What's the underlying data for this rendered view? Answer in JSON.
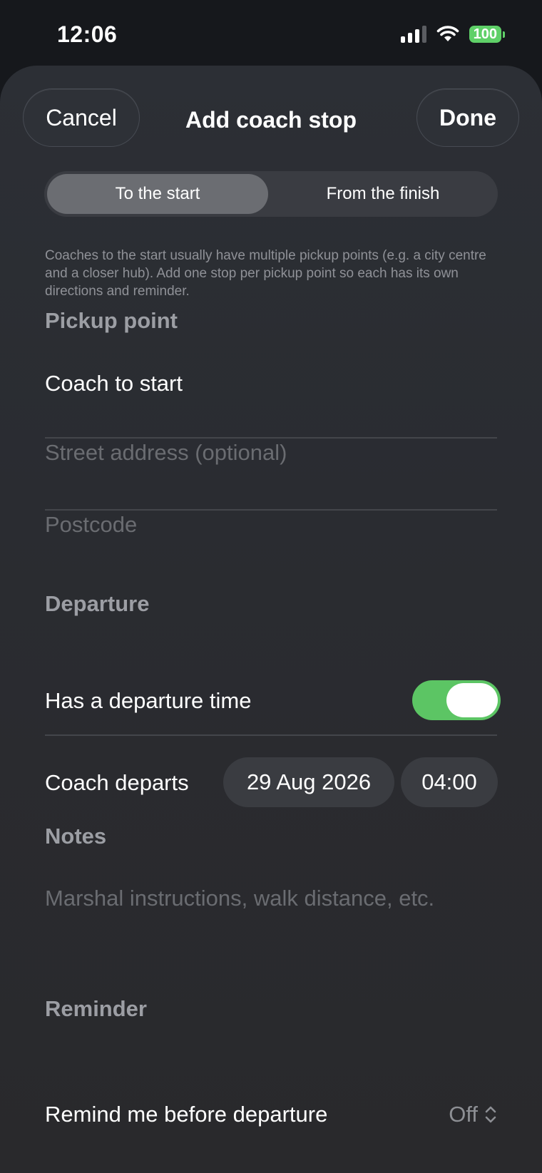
{
  "status_bar": {
    "time": "12:06",
    "battery": "100",
    "icons": [
      "cellular-signal-icon",
      "wifi-icon",
      "battery-icon"
    ],
    "battery_color": "#5fd068"
  },
  "nav": {
    "cancel_label": "Cancel",
    "title": "Add coach stop",
    "done_label": "Done"
  },
  "segmented": {
    "options": [
      "To the start",
      "From the finish"
    ],
    "selected": "To the start"
  },
  "helper_text": "Coaches to the start usually have multiple pickup points (e.g. a city centre and a closer hub). Add one stop per pickup point so each has its own directions and reminder.",
  "pickup": {
    "header": "Pickup point",
    "name_value": "Coach to start",
    "address_placeholder": "Street address (optional)",
    "postcode_placeholder": "Postcode"
  },
  "departure": {
    "header": "Departure",
    "toggle_label": "Has a departure time",
    "toggle_on": true,
    "toggle_color": "#5cc564",
    "departs_label": "Coach departs",
    "date": "29 Aug 2026",
    "time": "04:00"
  },
  "notes": {
    "header": "Notes",
    "placeholder": "Marshal instructions, walk distance, etc."
  },
  "reminder": {
    "header": "Reminder",
    "label": "Remind me before departure",
    "value": "Off"
  }
}
